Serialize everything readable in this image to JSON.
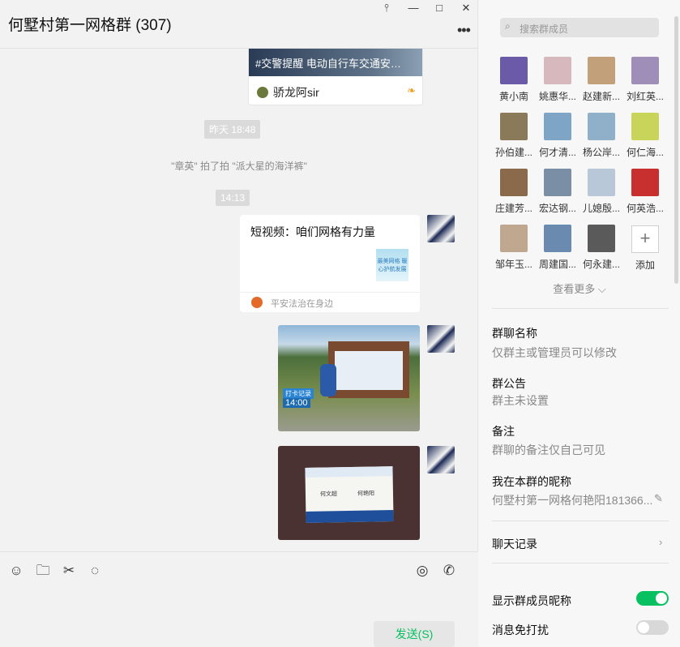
{
  "chat": {
    "title": "何墅村第一网格群 (307)",
    "window_buttons": {
      "pin": "pin-icon",
      "minimize": "minimize-icon",
      "maximize": "maximize-icon",
      "close": "close-icon"
    },
    "more_icon": "•••"
  },
  "messages": {
    "article_card": {
      "title": "#交警提醒 电动自行车交通安…",
      "source": "骄龙阿sir"
    },
    "time1": "昨天 18:48",
    "pat_notice": "\"章英\" 拍了拍 \"派大星的海洋裤\"",
    "time2": "14:13",
    "video_card": {
      "title": "短视频：咱们网格有力量",
      "thumb_text": "最美网格 暖心护航发展",
      "source": "平安法治在身边"
    },
    "photo1": {
      "tag": "打卡记录",
      "time": "14:00"
    },
    "photo2": {
      "name_left": "何文超",
      "name_right": "何艳阳"
    }
  },
  "composer": {
    "tools": [
      "emoji-icon",
      "folder-icon",
      "scissors-icon",
      "chat-bubble-icon"
    ],
    "right_tools": [
      "live-icon",
      "phone-icon"
    ],
    "send_label": "发送(S)"
  },
  "info": {
    "search_placeholder": "搜索群成员",
    "members": [
      {
        "name": "黄小南",
        "color": "#6a5aa8"
      },
      {
        "name": "姚惠华...",
        "color": "#d7b8bc"
      },
      {
        "name": "赵建新...",
        "color": "#c2a07a"
      },
      {
        "name": "刘红英...",
        "color": "#9f8fb8"
      },
      {
        "name": "孙伯建...",
        "color": "#8a7a5a"
      },
      {
        "name": "何才清...",
        "color": "#7ea5c5"
      },
      {
        "name": "杨公岸...",
        "color": "#8fb0c8"
      },
      {
        "name": "何仁海...",
        "color": "#c9d45a"
      },
      {
        "name": "庄建芳...",
        "color": "#8a6a4a"
      },
      {
        "name": "宏达钢...",
        "color": "#7a8fa5"
      },
      {
        "name": "儿媳殷...",
        "color": "#b8c8d8"
      },
      {
        "name": "何英浩...",
        "color": "#c83030"
      },
      {
        "name": "邹年玉...",
        "color": "#c0a890"
      },
      {
        "name": "周建国...",
        "color": "#6a8ab0"
      },
      {
        "name": "何永建...",
        "color": "#5a5a5a"
      }
    ],
    "add_label": "添加",
    "see_more": "查看更多",
    "group_name_label": "群聊名称",
    "group_name_value": "仅群主或管理员可以修改",
    "notice_label": "群公告",
    "notice_value": "群主未设置",
    "remark_label": "备注",
    "remark_value": "群聊的备注仅自己可见",
    "nickname_label": "我在本群的昵称",
    "nickname_value": "何墅村第一网格何艳阳181366...",
    "history_label": "聊天记录",
    "show_nick_label": "显示群成员昵称",
    "show_nick_on": true,
    "mute_label": "消息免打扰",
    "mute_on": false,
    "colors": {
      "accent": "#07c160",
      "toggle_off": "#d8d8d8"
    }
  }
}
